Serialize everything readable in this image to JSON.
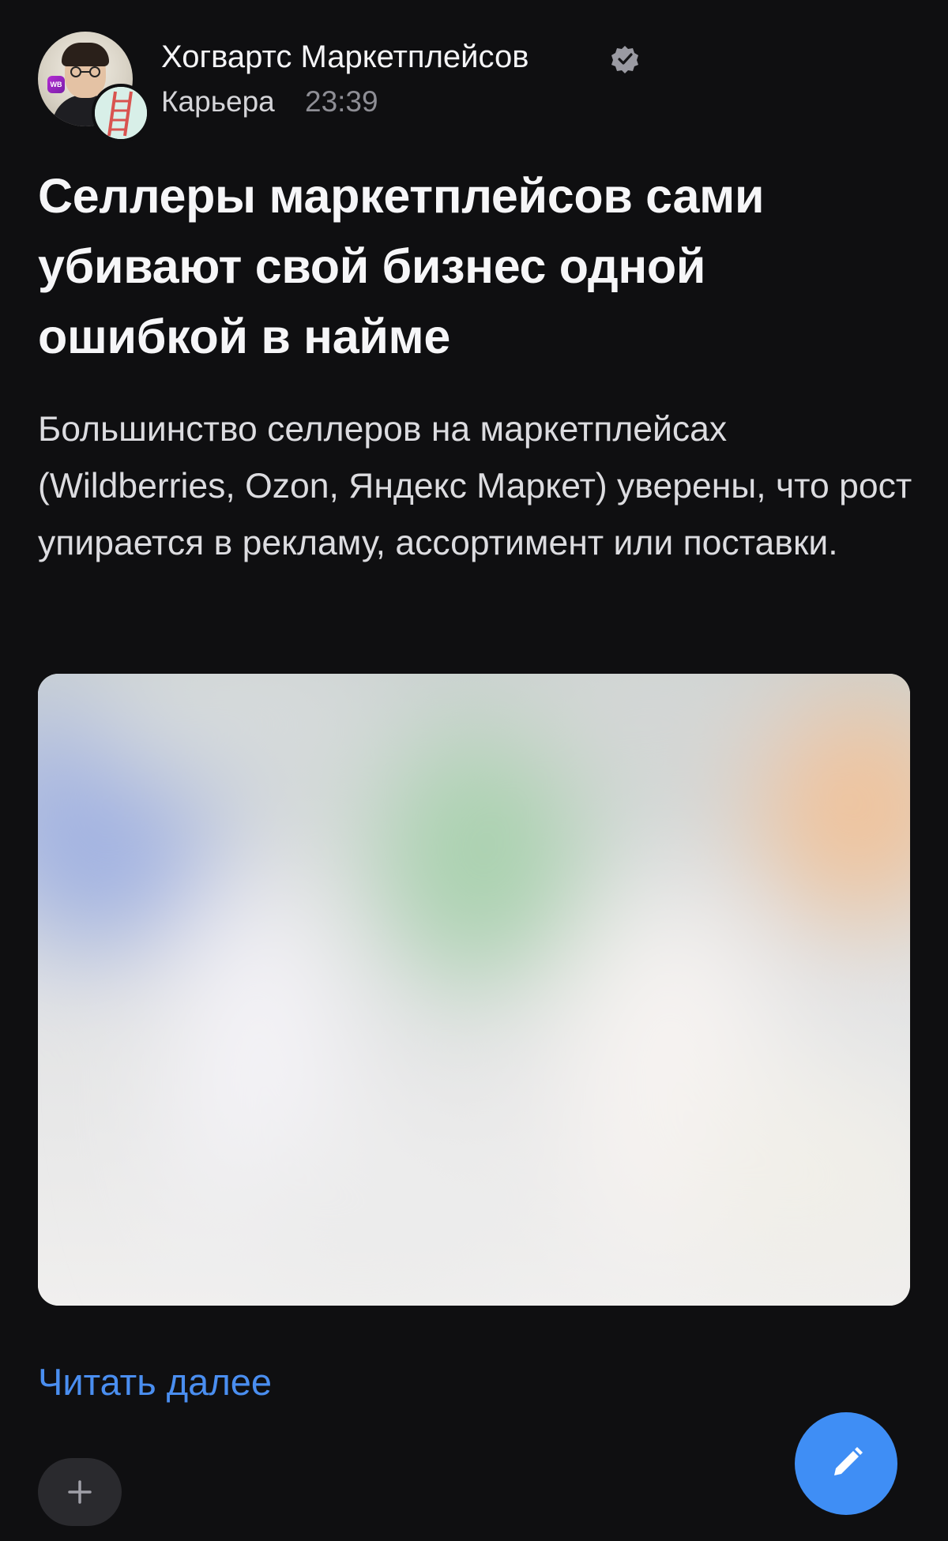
{
  "colors": {
    "background": "#0f0f11",
    "accent": "#3f8ef5",
    "link": "#4a8ef0",
    "secondary_text": "#8e8e95"
  },
  "header": {
    "channel_name": "Хогвартс Маркетплейсов",
    "category": "Карьера",
    "time": "23:39",
    "avatar_badge_text": "WB",
    "verified_icon": "verified-check-icon"
  },
  "post": {
    "title": "Селлеры маркетплейсов сами убивают свой бизнес одной ошибкой в найме",
    "lead": "Большинство селлеров на маркетплейсах (Wildberries, Ozon, Яндекс Маркет) уверены, что рост упирается в рекламу, ассортимент или поставки.",
    "read_more_label": "Читать далее"
  },
  "actions": {
    "add_reaction_icon": "plus-icon",
    "compose_icon": "pencil-icon"
  }
}
